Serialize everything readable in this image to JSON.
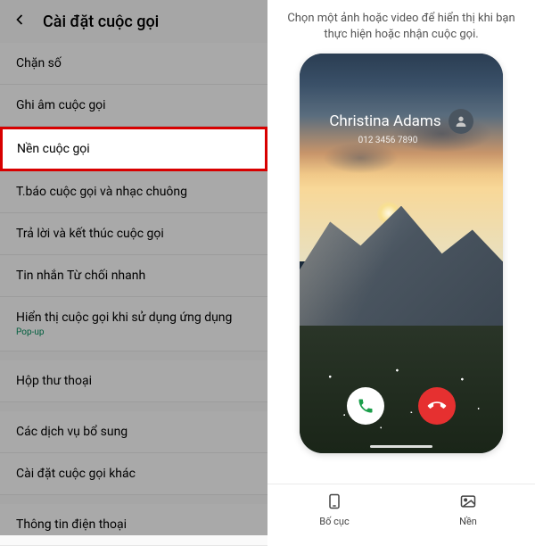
{
  "left": {
    "title": "Cài đặt cuộc gọi",
    "items": [
      {
        "label": "Chặn số"
      },
      {
        "label": "Ghi âm cuộc gọi"
      },
      {
        "label": "Nền cuộc gọi",
        "highlighted": true
      },
      {
        "label": "T.báo cuộc gọi và nhạc chuông"
      },
      {
        "label": "Trả lời và kết thúc cuộc gọi"
      },
      {
        "label": "Tin nhắn Từ chối nhanh"
      },
      {
        "label": "Hiển thị cuộc gọi khi sử dụng ứng dụng",
        "sub": "Pop-up"
      },
      {
        "label": "Hộp thư thoại",
        "gap": true
      },
      {
        "label": "Các dịch vụ bổ sung",
        "gap": true
      },
      {
        "label": "Cài đặt cuộc gọi khác"
      },
      {
        "label": "Thông tin điện thoại",
        "gap": true
      }
    ]
  },
  "right": {
    "description": "Chọn một ảnh hoặc video để hiển thị khi bạn thực hiện hoặc nhận cuộc gọi.",
    "caller_name": "Christina Adams",
    "caller_number": "012 3456 7890",
    "tabs": {
      "layout": "Bố cục",
      "background": "Nền"
    }
  }
}
